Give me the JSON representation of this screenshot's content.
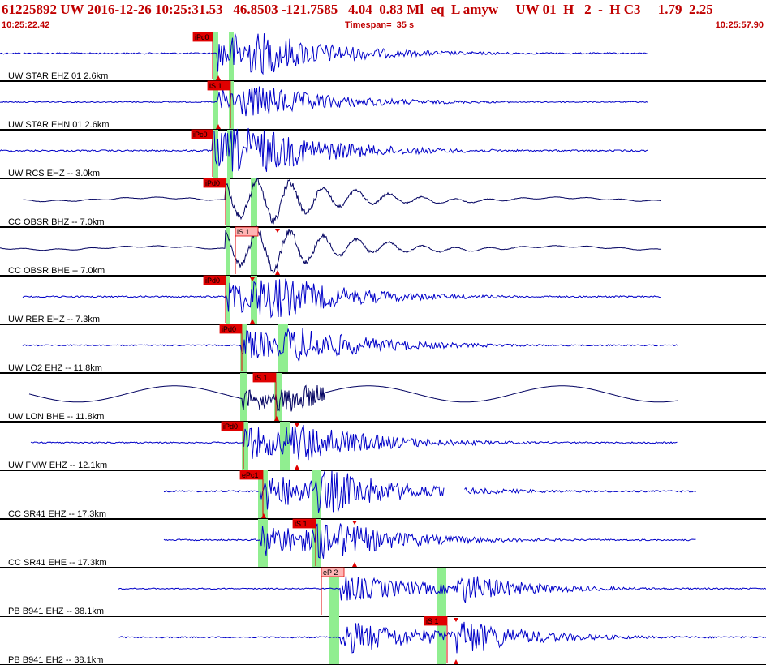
{
  "header": {
    "title": "61225892 UW 2016-12-26 10:25:31.53   46.8503 -121.7585   4.04  0.83 Ml  eq  L amyw     UW 01  H   2  -  H C3     1.79  2.25",
    "start_time": "10:25:22.42",
    "timespan_label": "Timespan=  35 s",
    "end_time": "10:25:57.90"
  },
  "colors": {
    "title_red": "#c00000",
    "trace_blue": "#0000c8",
    "trace_dark": "#000060",
    "pick_red": "#e00000",
    "pick_light": "#ffb4b4",
    "window_green": "#90ee90",
    "separator": "#000000"
  },
  "channels": [
    {
      "label": "UW STAR EHZ 01 2.6km",
      "color": "blue",
      "type": "hf"
    },
    {
      "label": "UW STAR EHN 01 2.6km",
      "color": "blue",
      "type": "hf"
    },
    {
      "label": "UW RCS EHZ -- 3.0km",
      "color": "blue",
      "type": "hf"
    },
    {
      "label": "CC OBSR BHZ -- 7.0km",
      "color": "dark",
      "type": "bb"
    },
    {
      "label": "CC OBSR BHE -- 7.0km",
      "color": "dark",
      "type": "bb"
    },
    {
      "label": "UW RER EHZ -- 7.3km",
      "color": "blue",
      "type": "hf"
    },
    {
      "label": "UW LO2 EHZ -- 11.8km",
      "color": "blue",
      "type": "hf"
    },
    {
      "label": "UW LON BHE -- 11.8km",
      "color": "dark",
      "type": "wave"
    },
    {
      "label": "UW FMW EHZ -- 12.1km",
      "color": "blue",
      "type": "hf"
    },
    {
      "label": "CC SR41 EHZ -- 17.3km",
      "color": "blue",
      "type": "hf"
    },
    {
      "label": "CC SR41 EHE -- 17.3km",
      "color": "blue",
      "type": "hf"
    },
    {
      "label": "PB B941 EHZ -- 38.1km",
      "color": "blue",
      "type": "hf"
    },
    {
      "label": "PB B941 EH2 -- 38.1km",
      "color": "blue",
      "type": "hf"
    }
  ],
  "picks": [
    {
      "channel": 0,
      "label": "iPc0",
      "style": "red"
    },
    {
      "channel": 1,
      "label": "iS 1",
      "style": "red"
    },
    {
      "channel": 2,
      "label": "iPc0",
      "style": "red"
    },
    {
      "channel": 3,
      "label": "iPd0",
      "style": "red"
    },
    {
      "channel": 4,
      "label": "iS 1",
      "style": "light"
    },
    {
      "channel": 5,
      "label": "iPd0",
      "style": "red"
    },
    {
      "channel": 6,
      "label": "iPd0",
      "style": "red"
    },
    {
      "channel": 7,
      "label": "iS 1",
      "style": "red"
    },
    {
      "channel": 8,
      "label": "iPd0",
      "style": "red"
    },
    {
      "channel": 9,
      "label": "ePc1",
      "style": "red"
    },
    {
      "channel": 10,
      "label": "iS 1",
      "style": "red"
    },
    {
      "channel": 11,
      "label": "eP 2",
      "style": "light"
    },
    {
      "channel": 12,
      "label": "iS 1",
      "style": "red"
    }
  ]
}
